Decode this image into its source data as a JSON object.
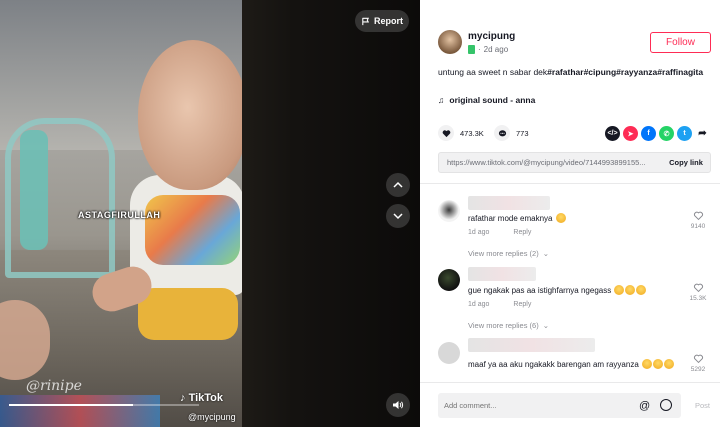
{
  "video": {
    "overlay_caption": "ASTAGFIRULLAH",
    "watermark_left": "@rinipe",
    "tiktok_brand": "TikTok",
    "tiktok_handle": "@mycipung",
    "progress": 0.65,
    "report_label": "Report",
    "nav_up_icon": "chevron-up-icon",
    "nav_down_icon": "chevron-down-icon",
    "volume_icon": "volume-icon"
  },
  "author": {
    "username": "mycipung",
    "time_ago": "2d ago",
    "follow_label": "Follow"
  },
  "post": {
    "desc_prefix": "untung aa sweet n sabar dek",
    "hashtags": [
      "#rafathar",
      "#cipung",
      "#rayyanza",
      "#raffinagita"
    ],
    "music": "original sound - anna",
    "likes": "473.3K",
    "comments": "773",
    "link_url": "https://www.tiktok.com/@mycipung/video/7144993899155...",
    "copy_label": "Copy link"
  },
  "share_colors": {
    "embed": "#161823",
    "send": "#fe2c55",
    "facebook": "#0075fa",
    "whatsapp": "#25d366",
    "twitter": "#1da1f2"
  },
  "comments": [
    {
      "text": "rafathar mode emaknya",
      "date": "1d ago",
      "reply_label": "Reply",
      "likes": "9140",
      "view_replies": "View more replies (2)"
    },
    {
      "text": "gue ngakak pas aa istighfarnya ngegass",
      "date": "1d ago",
      "reply_label": "Reply",
      "likes": "15.3K",
      "view_replies": "View more replies (6)"
    },
    {
      "text": "maaf ya aa aku ngakakk barengan am rayyanza",
      "likes": "5292"
    }
  ],
  "comment_bar": {
    "placeholder": "Add comment...",
    "post_label": "Post"
  }
}
